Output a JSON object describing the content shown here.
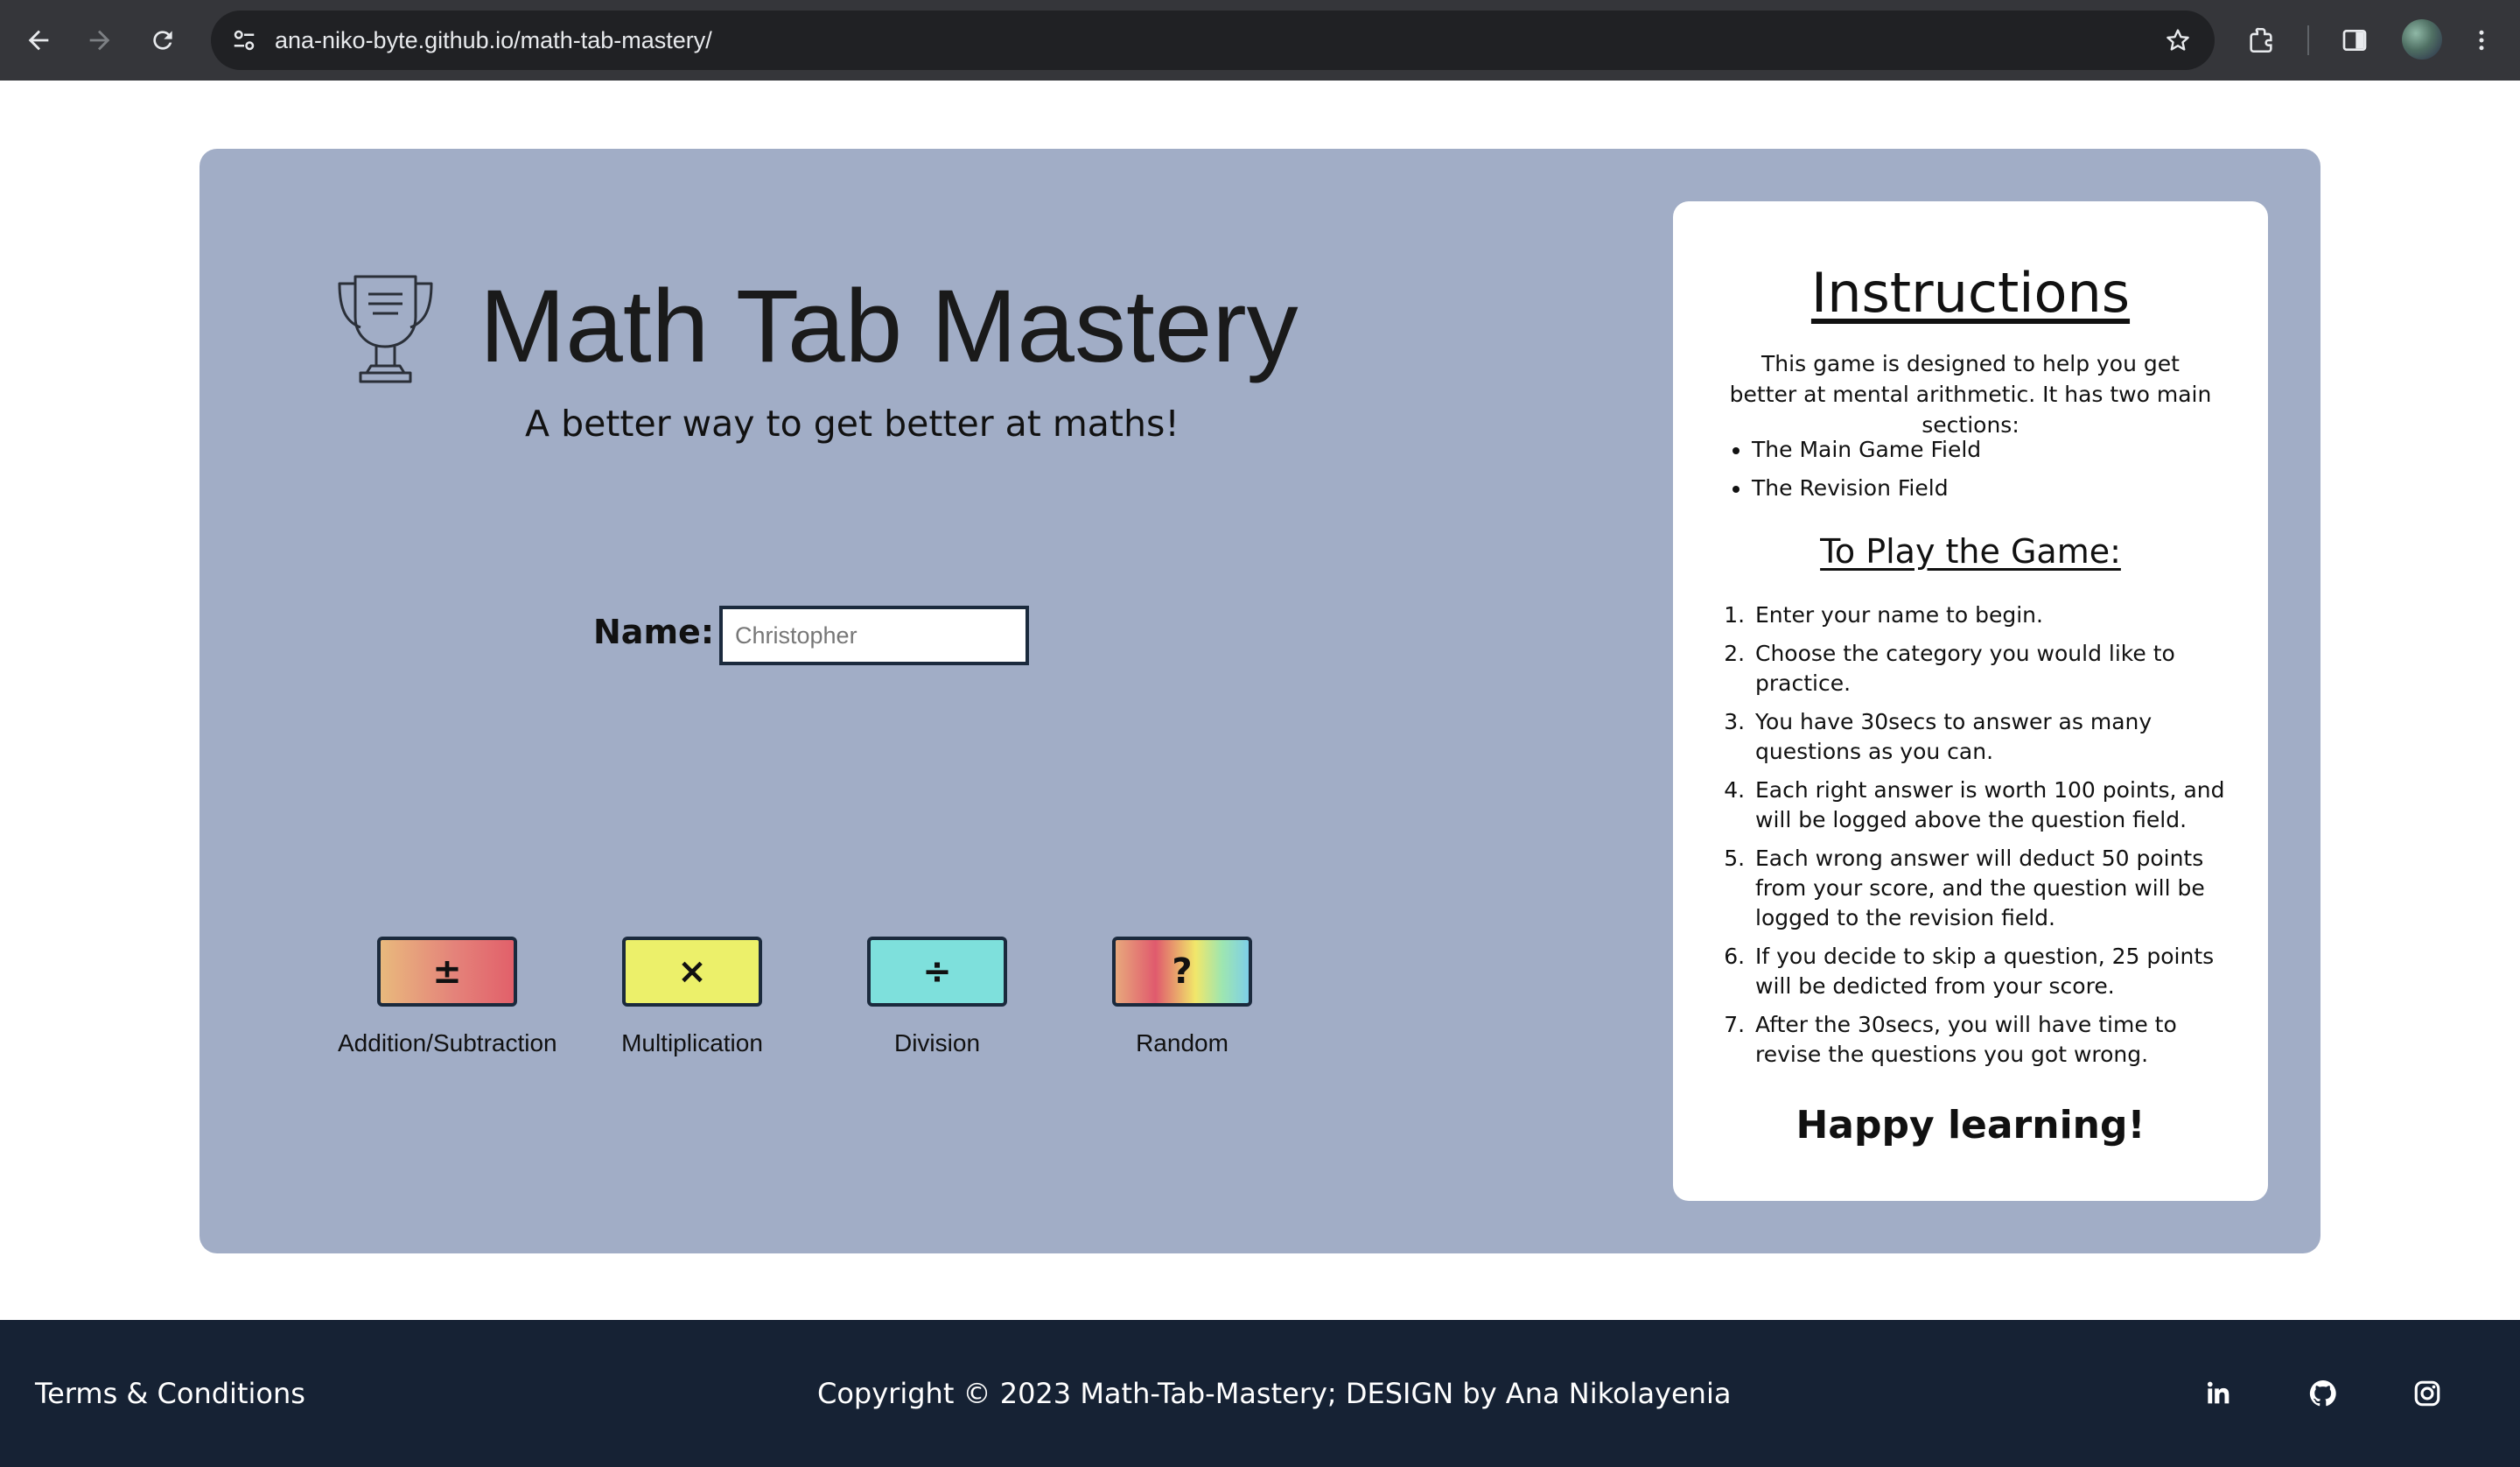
{
  "browser": {
    "url": "ana-niko-byte.github.io/math-tab-mastery/",
    "icons": [
      "back-icon",
      "forward-icon",
      "reload-icon",
      "site-settings-icon",
      "bookmark-star-icon",
      "extensions-icon",
      "side-panel-icon",
      "profile-avatar",
      "more-menu-icon"
    ]
  },
  "header": {
    "title": "Math Tab Mastery",
    "tagline": "A better way to get better at maths!",
    "logo_icon": "trophy-icon"
  },
  "name_form": {
    "label": "Name:",
    "placeholder": "Christopher",
    "value": ""
  },
  "categories": [
    {
      "symbol": "±",
      "label": "Addition/Subtraction"
    },
    {
      "symbol": "×",
      "label": "Multiplication"
    },
    {
      "symbol": "÷",
      "label": "Division"
    },
    {
      "symbol": "?",
      "label": "Random"
    }
  ],
  "instructions": {
    "title": "Instructions",
    "intro": "This game is designed to help you get better at mental arithmetic. It has two main sections:",
    "sections": [
      "The Main Game Field",
      "The Revision Field"
    ],
    "play_title": "To Play the Game:",
    "steps": [
      "Enter your name to begin.",
      "Choose the category you would like to practice.",
      "You have 30secs to answer as many questions as you can.",
      "Each right answer is worth 100 points, and will be logged above the question field.",
      "Each wrong answer will deduct 50 points from your score, and the question will be logged to the revision field.",
      "If you decide to skip a question, 25 points will be dedicted from your score.",
      "After the 30secs, you will have time to revise the questions you got wrong."
    ],
    "closing": "Happy learning!"
  },
  "footer": {
    "terms": "Terms & Conditions",
    "copyright": "Copyright © 2023 Math-Tab-Mastery; DESIGN by Ana Nikolayenia",
    "social_icons": [
      "linkedin-icon",
      "github-icon",
      "instagram-icon"
    ]
  },
  "colors": {
    "page_panel": "#a1adc6",
    "footer": "#162234",
    "multiplication": "#ecf06a",
    "division": "#7ee0dc",
    "addsub_gradient": [
      "#e9b97d",
      "#e2606a"
    ]
  }
}
